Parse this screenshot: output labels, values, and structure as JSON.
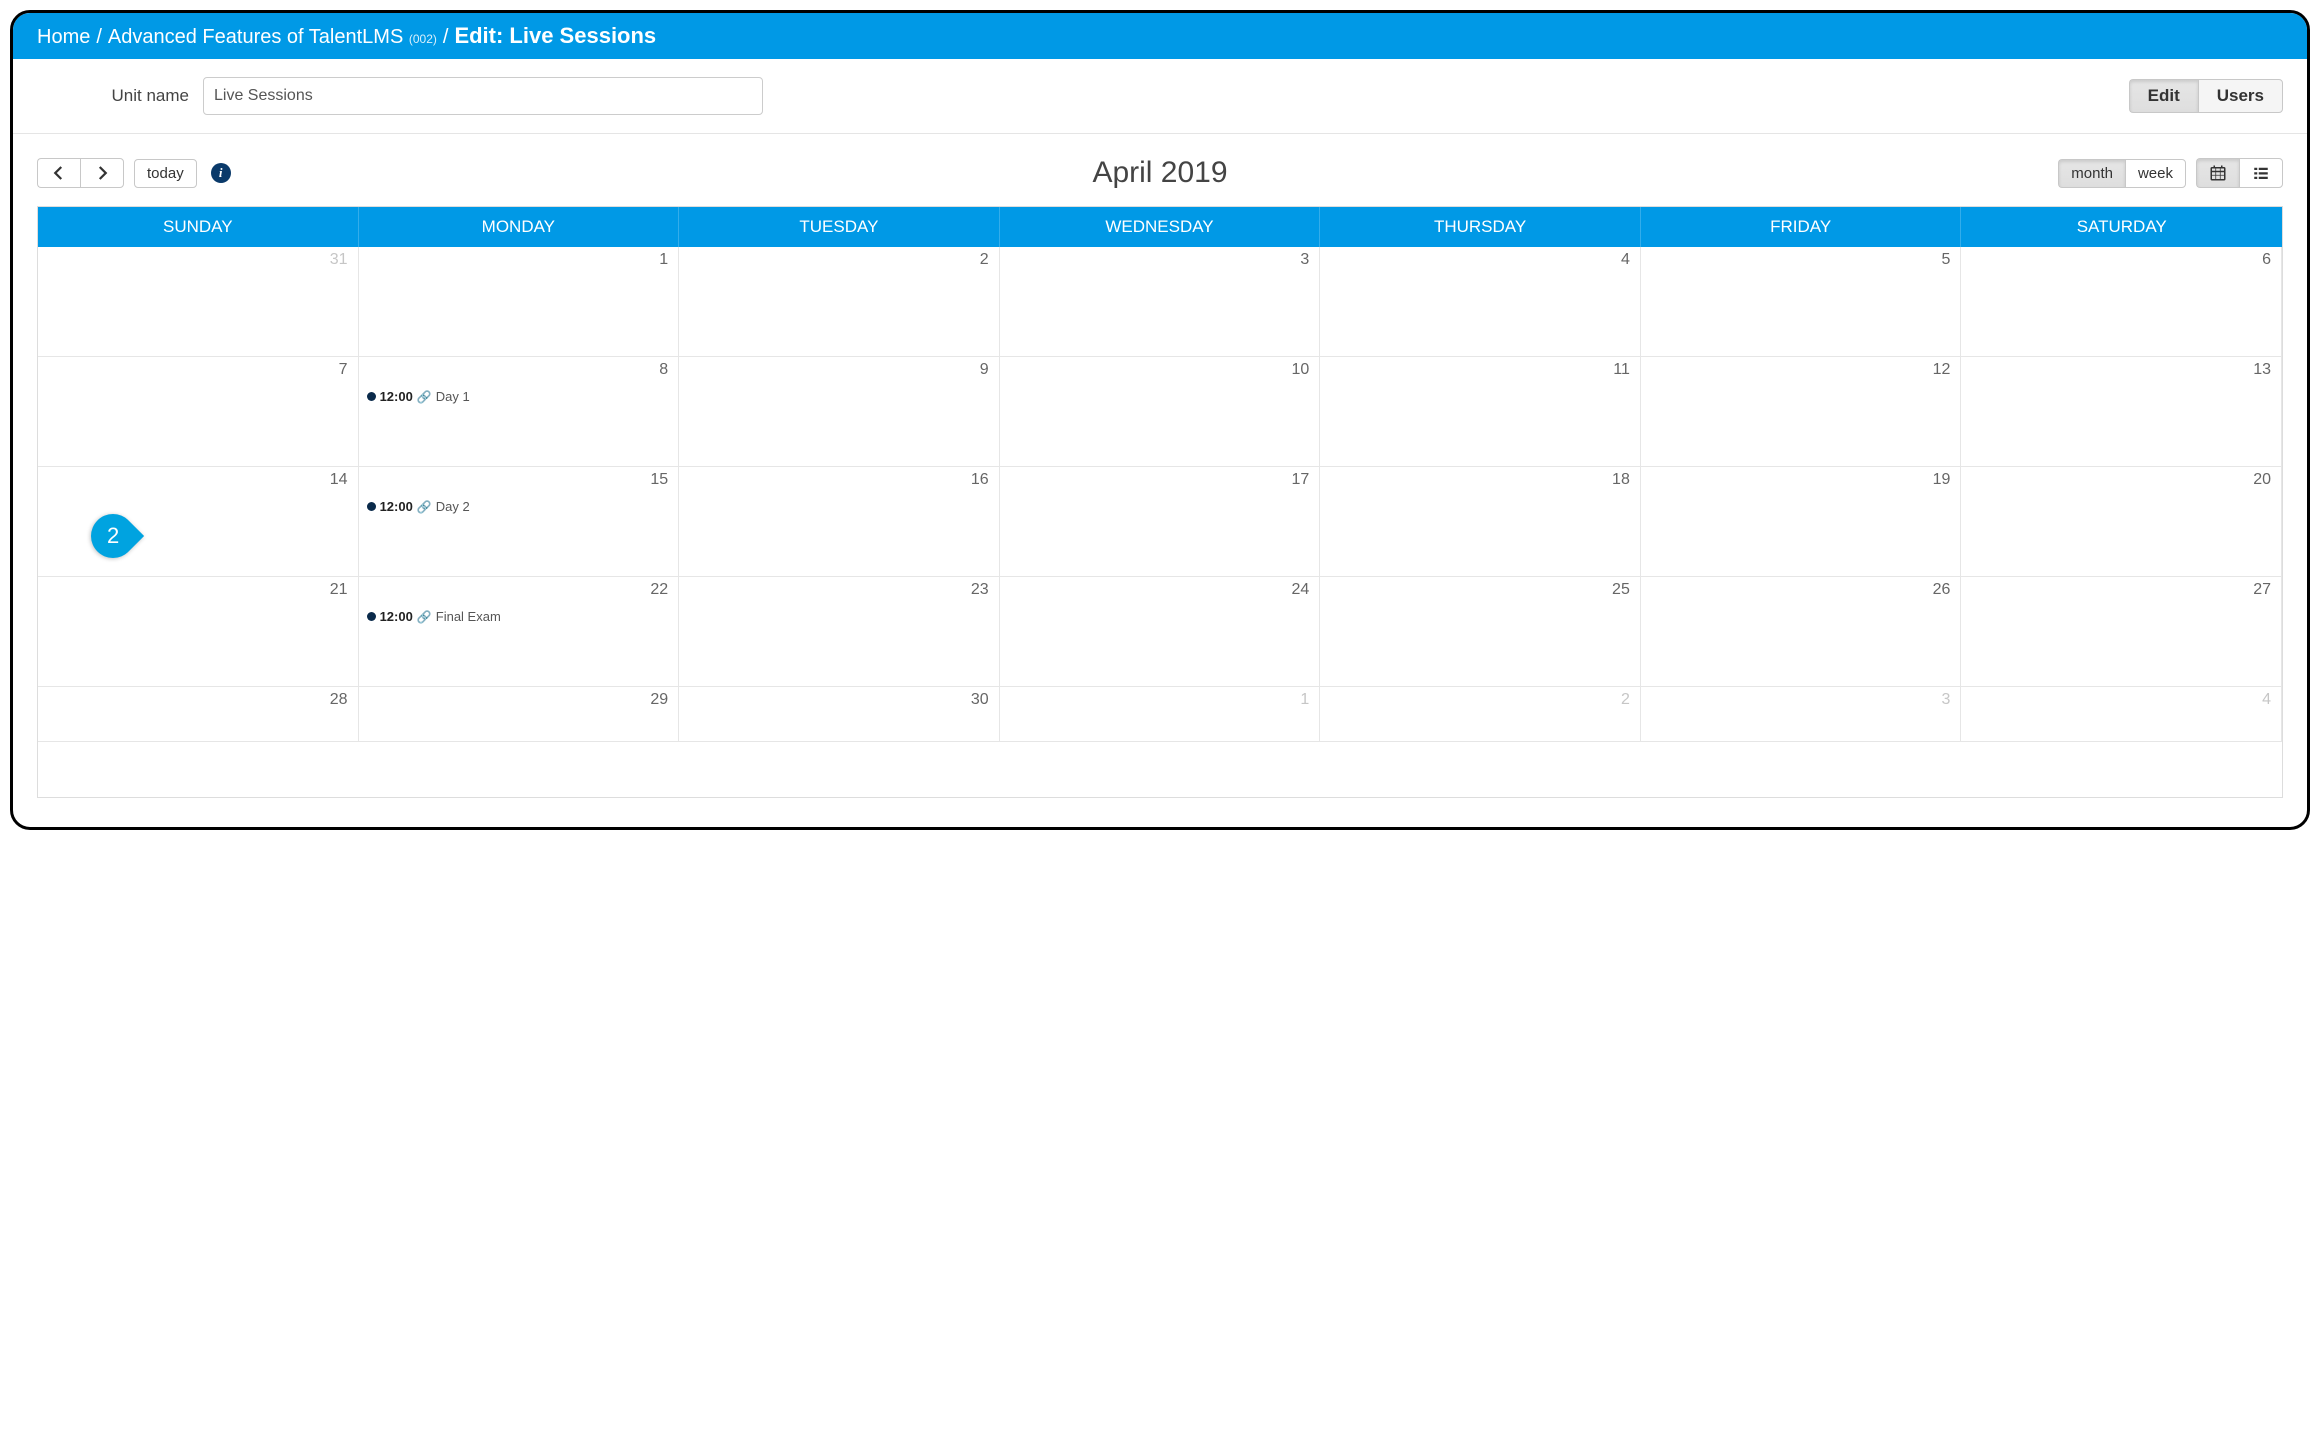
{
  "breadcrumb": {
    "home": "Home",
    "course": "Advanced Features of TalentLMS",
    "course_code": "(002)",
    "current": "Edit: Live Sessions"
  },
  "unit": {
    "label": "Unit name",
    "value": "Live Sessions",
    "actions": {
      "edit": "Edit",
      "users": "Users",
      "active": "edit"
    }
  },
  "calendar": {
    "title": "April 2019",
    "today_label": "today",
    "range": {
      "month": "month",
      "week": "week",
      "active": "month"
    },
    "day_headers": [
      "SUNDAY",
      "MONDAY",
      "TUESDAY",
      "WEDNESDAY",
      "THURSDAY",
      "FRIDAY",
      "SATURDAY"
    ],
    "weeks": [
      [
        {
          "n": "31",
          "other": true
        },
        {
          "n": "1"
        },
        {
          "n": "2"
        },
        {
          "n": "3"
        },
        {
          "n": "4"
        },
        {
          "n": "5"
        },
        {
          "n": "6"
        }
      ],
      [
        {
          "n": "7"
        },
        {
          "n": "8",
          "event": {
            "time": "12:00",
            "label": "Day 1"
          }
        },
        {
          "n": "9"
        },
        {
          "n": "10"
        },
        {
          "n": "11"
        },
        {
          "n": "12"
        },
        {
          "n": "13"
        }
      ],
      [
        {
          "n": "14"
        },
        {
          "n": "15",
          "event": {
            "time": "12:00",
            "label": "Day 2"
          }
        },
        {
          "n": "16"
        },
        {
          "n": "17"
        },
        {
          "n": "18"
        },
        {
          "n": "19"
        },
        {
          "n": "20"
        }
      ],
      [
        {
          "n": "21"
        },
        {
          "n": "22",
          "event": {
            "time": "12:00",
            "label": "Final Exam"
          }
        },
        {
          "n": "23"
        },
        {
          "n": "24"
        },
        {
          "n": "25"
        },
        {
          "n": "26"
        },
        {
          "n": "27"
        }
      ],
      [
        {
          "n": "28"
        },
        {
          "n": "29"
        },
        {
          "n": "30"
        },
        {
          "n": "1",
          "other": true
        },
        {
          "n": "2",
          "other": true
        },
        {
          "n": "3",
          "other": true
        },
        {
          "n": "4",
          "other": true
        }
      ]
    ],
    "annotation": {
      "step": "2"
    }
  }
}
